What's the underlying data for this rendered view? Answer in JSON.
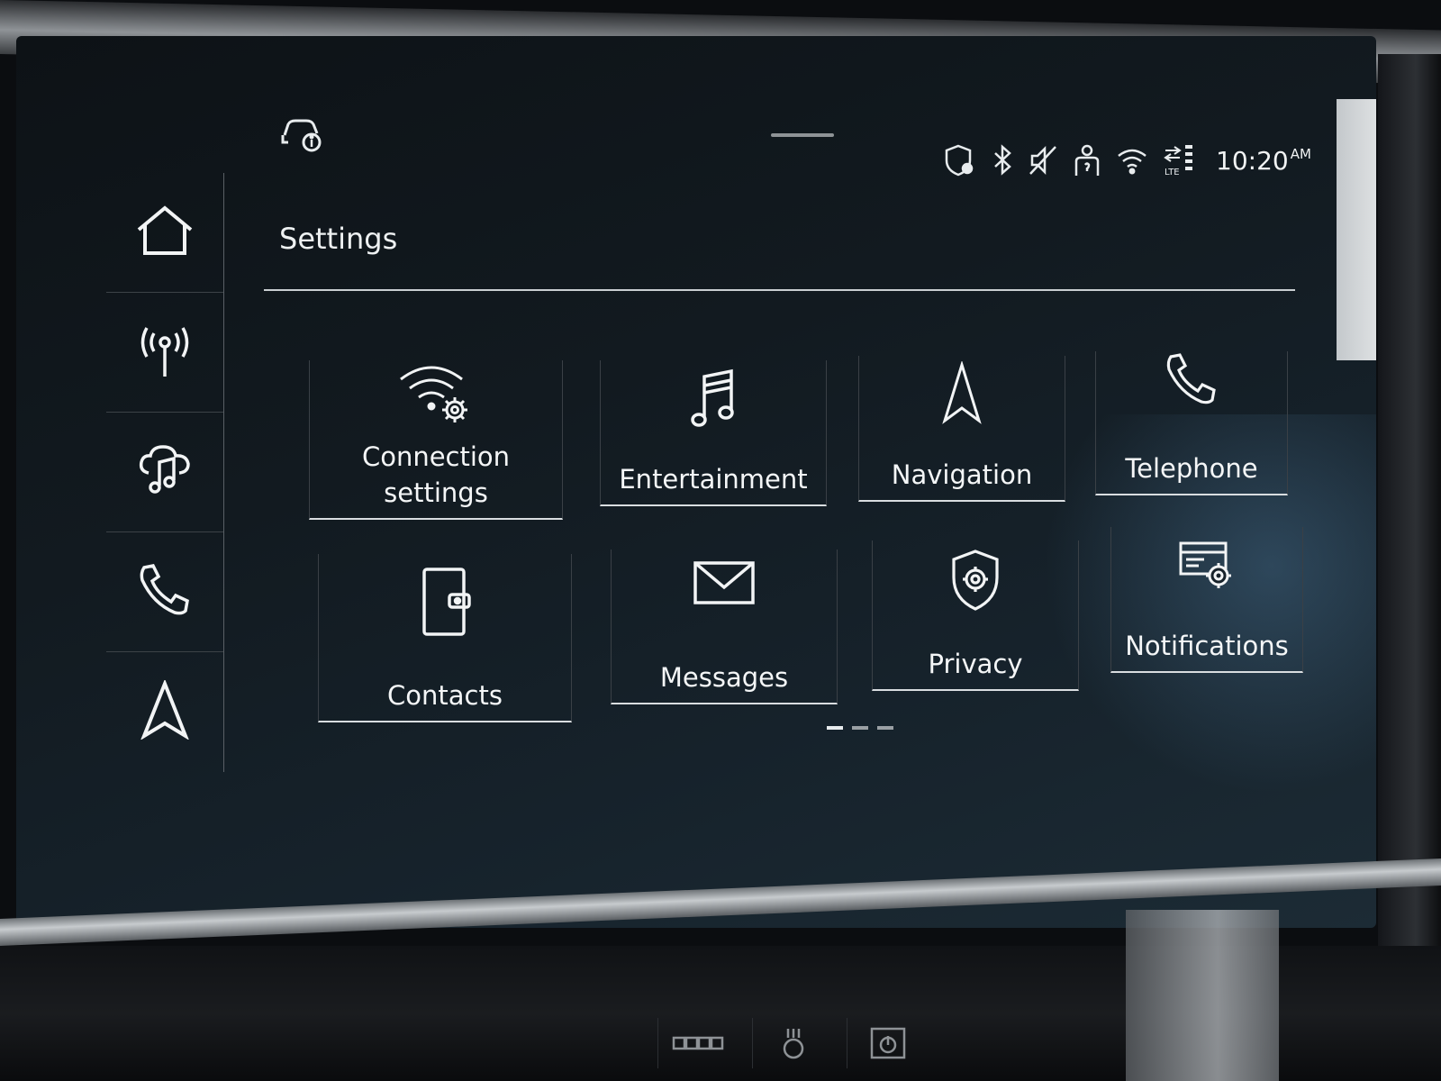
{
  "status_bar": {
    "icons": [
      "car-info-icon",
      "location-shield-icon",
      "bluetooth-icon",
      "mute-icon",
      "person-icon",
      "wifi-icon",
      "lte-icon"
    ],
    "time": "10:20",
    "meridiem": "AM"
  },
  "sidebar": {
    "items": [
      {
        "name": "home",
        "icon": "home-icon"
      },
      {
        "name": "radio",
        "icon": "radio-antenna-icon"
      },
      {
        "name": "media",
        "icon": "music-cloud-icon"
      },
      {
        "name": "phone",
        "icon": "phone-icon"
      },
      {
        "name": "navigation",
        "icon": "navigation-arrow-icon"
      }
    ]
  },
  "settings": {
    "title": "Settings",
    "tiles": [
      {
        "label_line1": "Connection",
        "label_line2": "settings",
        "icon": "wifi-gear-icon"
      },
      {
        "label": "Entertainment",
        "icon": "music-note-icon"
      },
      {
        "label": "Navigation",
        "icon": "navigation-arrow-icon"
      },
      {
        "label": "Telephone",
        "icon": "phone-icon"
      },
      {
        "label": "Contacts",
        "icon": "contact-book-icon"
      },
      {
        "label": "Messages",
        "icon": "envelope-icon"
      },
      {
        "label": "Privacy",
        "icon": "shield-gear-icon"
      },
      {
        "label": "Notifications",
        "icon": "notification-settings-icon"
      }
    ],
    "pages": 3,
    "current_page": 1
  },
  "colors": {
    "screen_background": "#121a20",
    "foreground": "#f4f6f7",
    "divider": "#c9ced1"
  }
}
